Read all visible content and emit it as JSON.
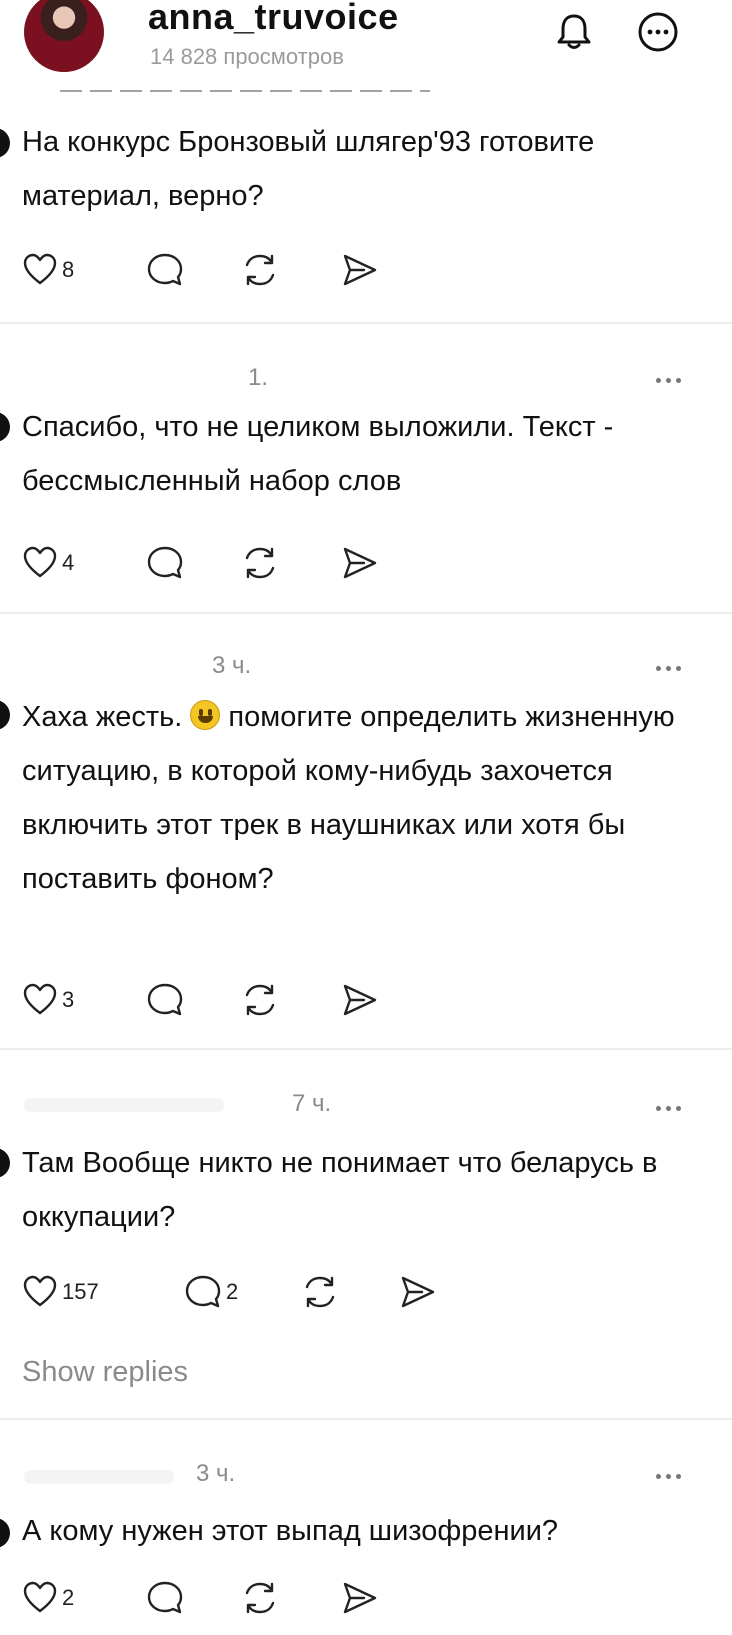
{
  "header": {
    "username": "anna_truvoice",
    "views": "14 828 просмотров"
  },
  "comments": [
    {
      "time": "",
      "text": "На конкурс Бронзовый шлягер'93 готовите материал, верно?",
      "likes": "8",
      "replies_count": ""
    },
    {
      "time": "1.",
      "text": "Спасибо, что не целиком выложили. Текст - бессмысленный набор слов",
      "likes": "4",
      "replies_count": ""
    },
    {
      "time": "3 ч.",
      "text_before_emoji": "Хаха жесть. ",
      "text_after_emoji": " помогите определить жизненную ситуацию, в которой кому-нибудь захочется включить этот трек в наушниках или хотя бы поставить фоном?",
      "likes": "3",
      "replies_count": ""
    },
    {
      "time": "7 ч.",
      "text": "Там Вообще никто не понимает что беларусь в оккупации?",
      "likes": "157",
      "replies_count": "2",
      "show_replies": "Show replies"
    },
    {
      "time": "3 ч.",
      "text": "А кому нужен этот выпад шизофрении?",
      "likes": "2",
      "replies_count": ""
    }
  ],
  "icons": [
    "bell-icon",
    "more-circle-icon",
    "heart-icon",
    "comment-icon",
    "repost-icon",
    "share-icon",
    "more-dots-icon"
  ]
}
